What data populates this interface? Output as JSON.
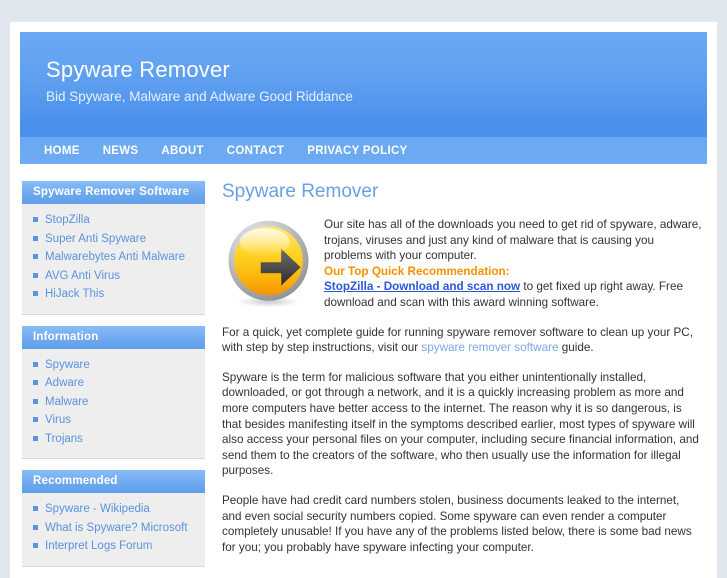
{
  "header": {
    "title": "Spyware Remover",
    "tagline": "Bid Spyware, Malware and Adware Good Riddance"
  },
  "nav": {
    "items": [
      {
        "label": "HOME"
      },
      {
        "label": "NEWS"
      },
      {
        "label": "ABOUT"
      },
      {
        "label": "CONTACT"
      },
      {
        "label": "PRIVACY POLICY"
      }
    ]
  },
  "sidebar": {
    "boxes": [
      {
        "title": "Spyware Remover Software",
        "items": [
          {
            "label": "StopZilla"
          },
          {
            "label": "Super Anti Spyware"
          },
          {
            "label": "Malwarebytes Anti Malware"
          },
          {
            "label": "AVG Anti Virus"
          },
          {
            "label": "HiJack This"
          }
        ]
      },
      {
        "title": "Information",
        "items": [
          {
            "label": "Spyware"
          },
          {
            "label": "Adware"
          },
          {
            "label": "Malware"
          },
          {
            "label": "Virus"
          },
          {
            "label": "Trojans"
          }
        ]
      },
      {
        "title": "Recommended",
        "items": [
          {
            "label": "Spyware - Wikipedia"
          },
          {
            "label": "What is Spyware? Microsoft"
          },
          {
            "label": "Interpret Logs Forum"
          }
        ]
      }
    ]
  },
  "main": {
    "page_title": "Spyware Remover",
    "icon_name": "yellow-arrow-right-icon",
    "intro_paragraph": "Our site has all of the downloads you need to get rid of spyware, adware, trojans, viruses and just any kind of malware that is causing you problems with your computer.",
    "recommendation_label": "Our Top Quick Recommendation:",
    "cta_link": "StopZilla - Download and scan now",
    "cta_tail": " to get fixed up right away. Free download and scan with this award winning software.",
    "guide_paragraph_pre": "For a quick, yet complete guide for running spyware remover software to clean up your PC, with step by step instructions, visit our ",
    "guide_link": "spyware remover software",
    "guide_paragraph_post": " guide.",
    "spyware_definition": "Spyware is the term for malicious software that you either unintentionally installed, downloaded, or got through a network, and it is a quickly increasing problem as more and more computers have better access to the internet. The reason why it is so dangerous, is that besides manifesting itself in the symptoms described earlier, most types of spyware will also access your personal files on your computer, including secure financial information, and send them to the creators of the software, who then usually use the information for illegal purposes.",
    "consequences_paragraph": "People have had credit card numbers stolen, business documents leaked to the internet, and even social security numbers copied. Some spyware can even render a computer completely unusable! If you have any of the problems listed below, there is some bad news for you; you probably have spyware infecting your computer."
  },
  "colors": {
    "header_blue": "#5f9ff0",
    "nav_blue": "#6fabf2",
    "sidebar_panel": "#eeeeee",
    "link_blue": "#5a92dd",
    "heading_blue": "#6aa0e2",
    "accent_orange": "#f49200",
    "cta_blue": "#2b59d6",
    "page_bg": "#dfe6ee"
  }
}
